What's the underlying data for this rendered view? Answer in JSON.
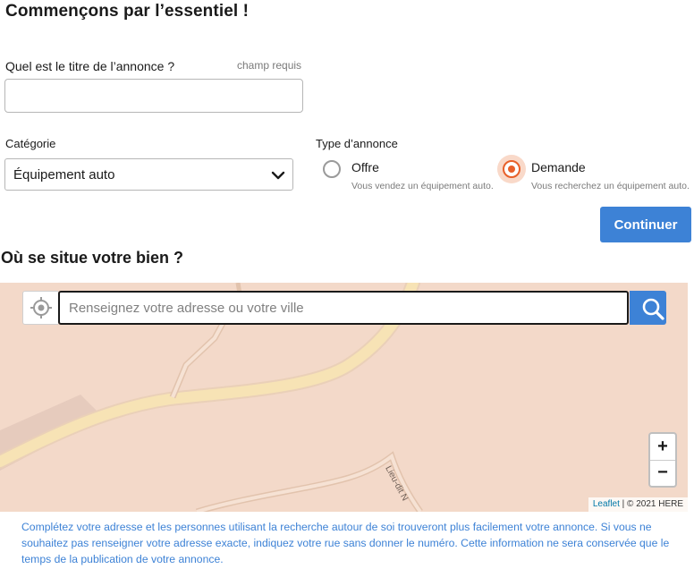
{
  "heading": "Commençons par l’essentiel !",
  "title_field": {
    "label": "Quel est le titre de l’annonce ?",
    "required_hint": "champ requis",
    "value": ""
  },
  "category": {
    "label": "Catégorie",
    "selected": "Équipement auto"
  },
  "ad_type": {
    "label": "Type d’annonce",
    "options": [
      {
        "label": "Offre",
        "description": "Vous vendez un équipement auto.",
        "selected": false
      },
      {
        "label": "Demande",
        "description": "Vous recherchez un équipement auto.",
        "selected": true
      }
    ]
  },
  "continue_label": "Continuer",
  "location": {
    "heading": "Où se situe votre bien ?",
    "search_placeholder": "Renseignez votre adresse ou votre ville",
    "map_label": "Lieu-dit N",
    "zoom_in": "+",
    "zoom_out": "−",
    "attribution_leaflet": "Leaflet",
    "attribution_rest": " | © 2021 HERE",
    "info": "Complétez votre adresse et les personnes utilisant la recherche autour de soi trouveront plus facilement votre annonce. Si vous ne souhaitez pas renseigner votre adresse exacte, indiquez votre rue sans donner le numéro. Cette information ne sera conservée que le temps de la publication de votre annonce."
  },
  "colors": {
    "accent": "#3d82d6",
    "radio_selected": "#e8602a",
    "map_background": "#f3d9c9",
    "road": "#f7e3b5"
  },
  "icons": [
    "chevron-down-icon",
    "locate-icon",
    "search-icon"
  ]
}
